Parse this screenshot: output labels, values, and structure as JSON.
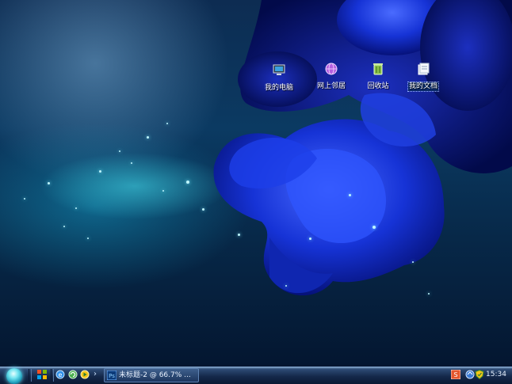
{
  "desktop": {
    "icons": [
      {
        "label": "我的电脑",
        "icon": "computer-icon"
      },
      {
        "label": "网上邻居",
        "icon": "network-icon"
      },
      {
        "label": "回收站",
        "icon": "recycle-bin-icon"
      },
      {
        "label": "我的文档",
        "icon": "documents-icon"
      }
    ]
  },
  "taskbar": {
    "quick_launch_arrow": "›",
    "task": {
      "label": "未标题-2 @ 66.7% ...",
      "icon": "photoshop-icon"
    },
    "tray": {
      "icons": [
        "sogou-input-icon",
        "network-status-icon",
        "shield-icon"
      ]
    },
    "clock": "15:34"
  },
  "colors": {
    "accent": "#1b43d6",
    "taskbar": "#14284a"
  }
}
